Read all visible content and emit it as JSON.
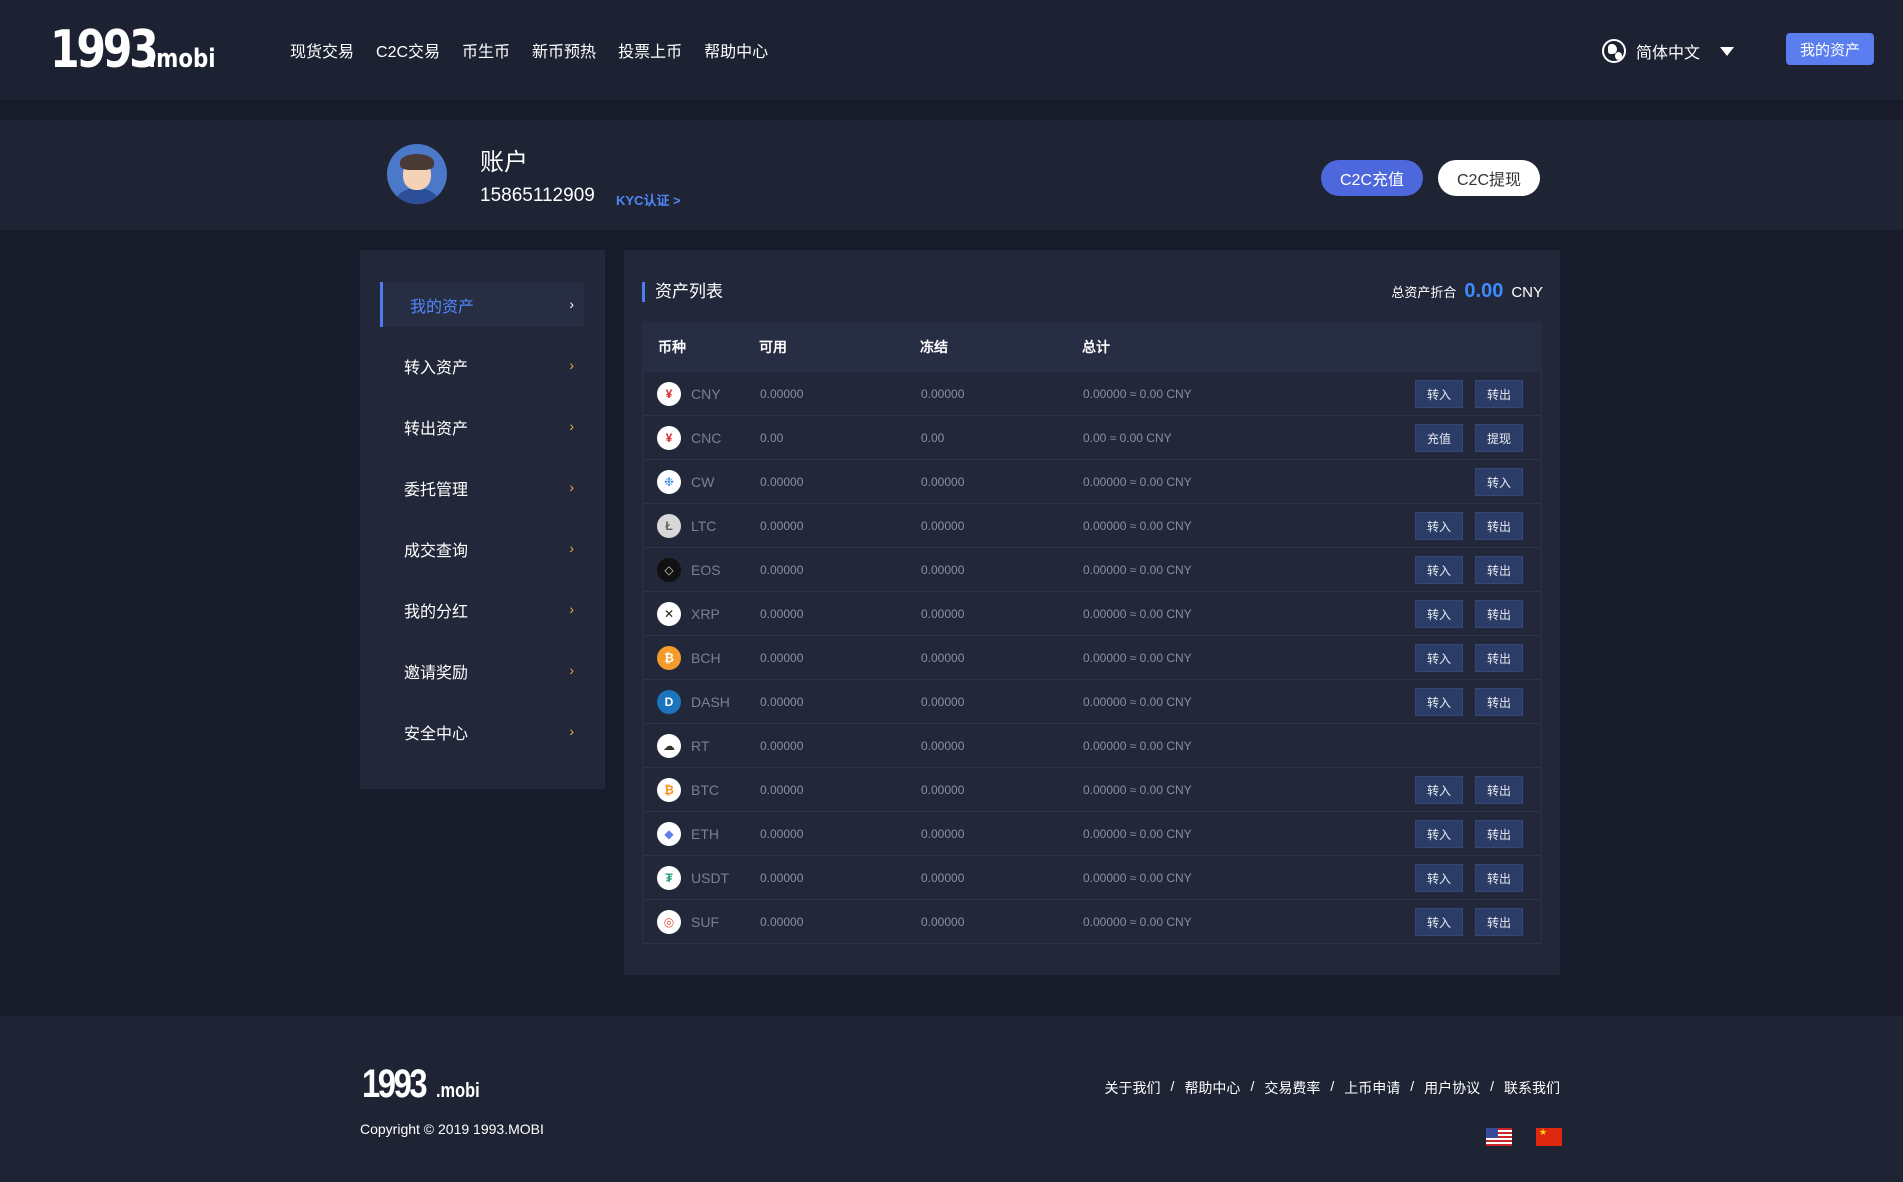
{
  "header": {
    "logo_main": "1993",
    "logo_suffix": ".mobi",
    "nav": [
      "现货交易",
      "C2C交易",
      "币生币",
      "新币预热",
      "投票上币",
      "帮助中心"
    ],
    "language": "简体中文",
    "my_assets_button": "我的资产"
  },
  "account": {
    "title": "账户",
    "phone": "15865112909",
    "kyc_link": "KYC认证 >",
    "c2c_deposit": "C2C充值",
    "c2c_withdraw": "C2C提现"
  },
  "sidebar": {
    "items": [
      {
        "label": "我的资产",
        "active": true
      },
      {
        "label": "转入资产",
        "active": false
      },
      {
        "label": "转出资产",
        "active": false
      },
      {
        "label": "委托管理",
        "active": false
      },
      {
        "label": "成交查询",
        "active": false
      },
      {
        "label": "我的分红",
        "active": false
      },
      {
        "label": "邀请奖励",
        "active": false
      },
      {
        "label": "安全中心",
        "active": false
      }
    ],
    "chevron": "›"
  },
  "assets": {
    "title": "资产列表",
    "total_label": "总资产折合",
    "total_value": "0.00",
    "total_currency": "CNY",
    "columns": [
      "币种",
      "可用",
      "冻结",
      "总计"
    ],
    "rows": [
      {
        "symbol": "CNY",
        "icon": "yuan-icon",
        "icon_glyph": "¥",
        "icon_bg": "#ffffff",
        "icon_fg": "#d9262c",
        "available": "0.00000",
        "frozen": "0.00000",
        "total": "0.00000 ≈ 0.00 CNY",
        "actions": [
          "转入",
          "转出"
        ]
      },
      {
        "symbol": "CNC",
        "icon": "yuan-icon",
        "icon_glyph": "¥",
        "icon_bg": "#ffffff",
        "icon_fg": "#d9262c",
        "available": "0.00",
        "frozen": "0.00",
        "total": "0.00 ≈ 0.00 CNY",
        "actions": [
          "充值",
          "提现"
        ]
      },
      {
        "symbol": "CW",
        "icon": "cw-coin-icon",
        "icon_glyph": "❉",
        "icon_bg": "#ffffff",
        "icon_fg": "#3b8fe0",
        "available": "0.00000",
        "frozen": "0.00000",
        "total": "0.00000 ≈ 0.00 CNY",
        "actions": [
          "转入"
        ]
      },
      {
        "symbol": "LTC",
        "icon": "litecoin-icon",
        "icon_glyph": "Ł",
        "icon_bg": "#d8d8d8",
        "icon_fg": "#5f5f5f",
        "available": "0.00000",
        "frozen": "0.00000",
        "total": "0.00000 ≈ 0.00 CNY",
        "actions": [
          "转入",
          "转出"
        ]
      },
      {
        "symbol": "EOS",
        "icon": "eos-icon",
        "icon_glyph": "◇",
        "icon_bg": "#111111",
        "icon_fg": "#cccccc",
        "available": "0.00000",
        "frozen": "0.00000",
        "total": "0.00000 ≈ 0.00 CNY",
        "actions": [
          "转入",
          "转出"
        ]
      },
      {
        "symbol": "XRP",
        "icon": "xrp-icon",
        "icon_glyph": "✕",
        "icon_bg": "#ffffff",
        "icon_fg": "#222222",
        "available": "0.00000",
        "frozen": "0.00000",
        "total": "0.00000 ≈ 0.00 CNY",
        "actions": [
          "转入",
          "转出"
        ]
      },
      {
        "symbol": "BCH",
        "icon": "bitcoin-cash-icon",
        "icon_glyph": "₿",
        "icon_bg": "#f39c2b",
        "icon_fg": "#ffffff",
        "available": "0.00000",
        "frozen": "0.00000",
        "total": "0.00000 ≈ 0.00 CNY",
        "actions": [
          "转入",
          "转出"
        ]
      },
      {
        "symbol": "DASH",
        "icon": "dash-icon",
        "icon_glyph": "D",
        "icon_bg": "#1c75bc",
        "icon_fg": "#ffffff",
        "available": "0.00000",
        "frozen": "0.00000",
        "total": "0.00000 ≈ 0.00 CNY",
        "actions": [
          "转入",
          "转出"
        ]
      },
      {
        "symbol": "RT",
        "icon": "rt-coin-icon",
        "icon_glyph": "☁",
        "icon_bg": "#ffffff",
        "icon_fg": "#333333",
        "available": "0.00000",
        "frozen": "0.00000",
        "total": "0.00000 ≈ 0.00 CNY",
        "actions": []
      },
      {
        "symbol": "BTC",
        "icon": "bitcoin-icon",
        "icon_glyph": "₿",
        "icon_bg": "#ffffff",
        "icon_fg": "#f7931a",
        "available": "0.00000",
        "frozen": "0.00000",
        "total": "0.00000 ≈ 0.00 CNY",
        "actions": [
          "转入",
          "转出"
        ]
      },
      {
        "symbol": "ETH",
        "icon": "ethereum-icon",
        "icon_glyph": "◆",
        "icon_bg": "#ffffff",
        "icon_fg": "#627eea",
        "available": "0.00000",
        "frozen": "0.00000",
        "total": "0.00000 ≈ 0.00 CNY",
        "actions": [
          "转入",
          "转出"
        ]
      },
      {
        "symbol": "USDT",
        "icon": "tether-icon",
        "icon_glyph": "₮",
        "icon_bg": "#ffffff",
        "icon_fg": "#26a17b",
        "available": "0.00000",
        "frozen": "0.00000",
        "total": "0.00000 ≈ 0.00 CNY",
        "actions": [
          "转入",
          "转出"
        ]
      },
      {
        "symbol": "SUF",
        "icon": "suf-coin-icon",
        "icon_glyph": "◎",
        "icon_bg": "#ffffff",
        "icon_fg": "#e2533a",
        "available": "0.00000",
        "frozen": "0.00000",
        "total": "0.00000 ≈ 0.00 CNY",
        "actions": [
          "转入",
          "转出"
        ]
      }
    ]
  },
  "footer": {
    "logo_main": "1993",
    "logo_suffix": ".mobi",
    "copyright": "Copyright © 2019 1993.MOBI",
    "links": [
      "关于我们",
      "帮助中心",
      "交易费率",
      "上币申请",
      "用户协议",
      "联系我们"
    ],
    "separator": "/"
  }
}
